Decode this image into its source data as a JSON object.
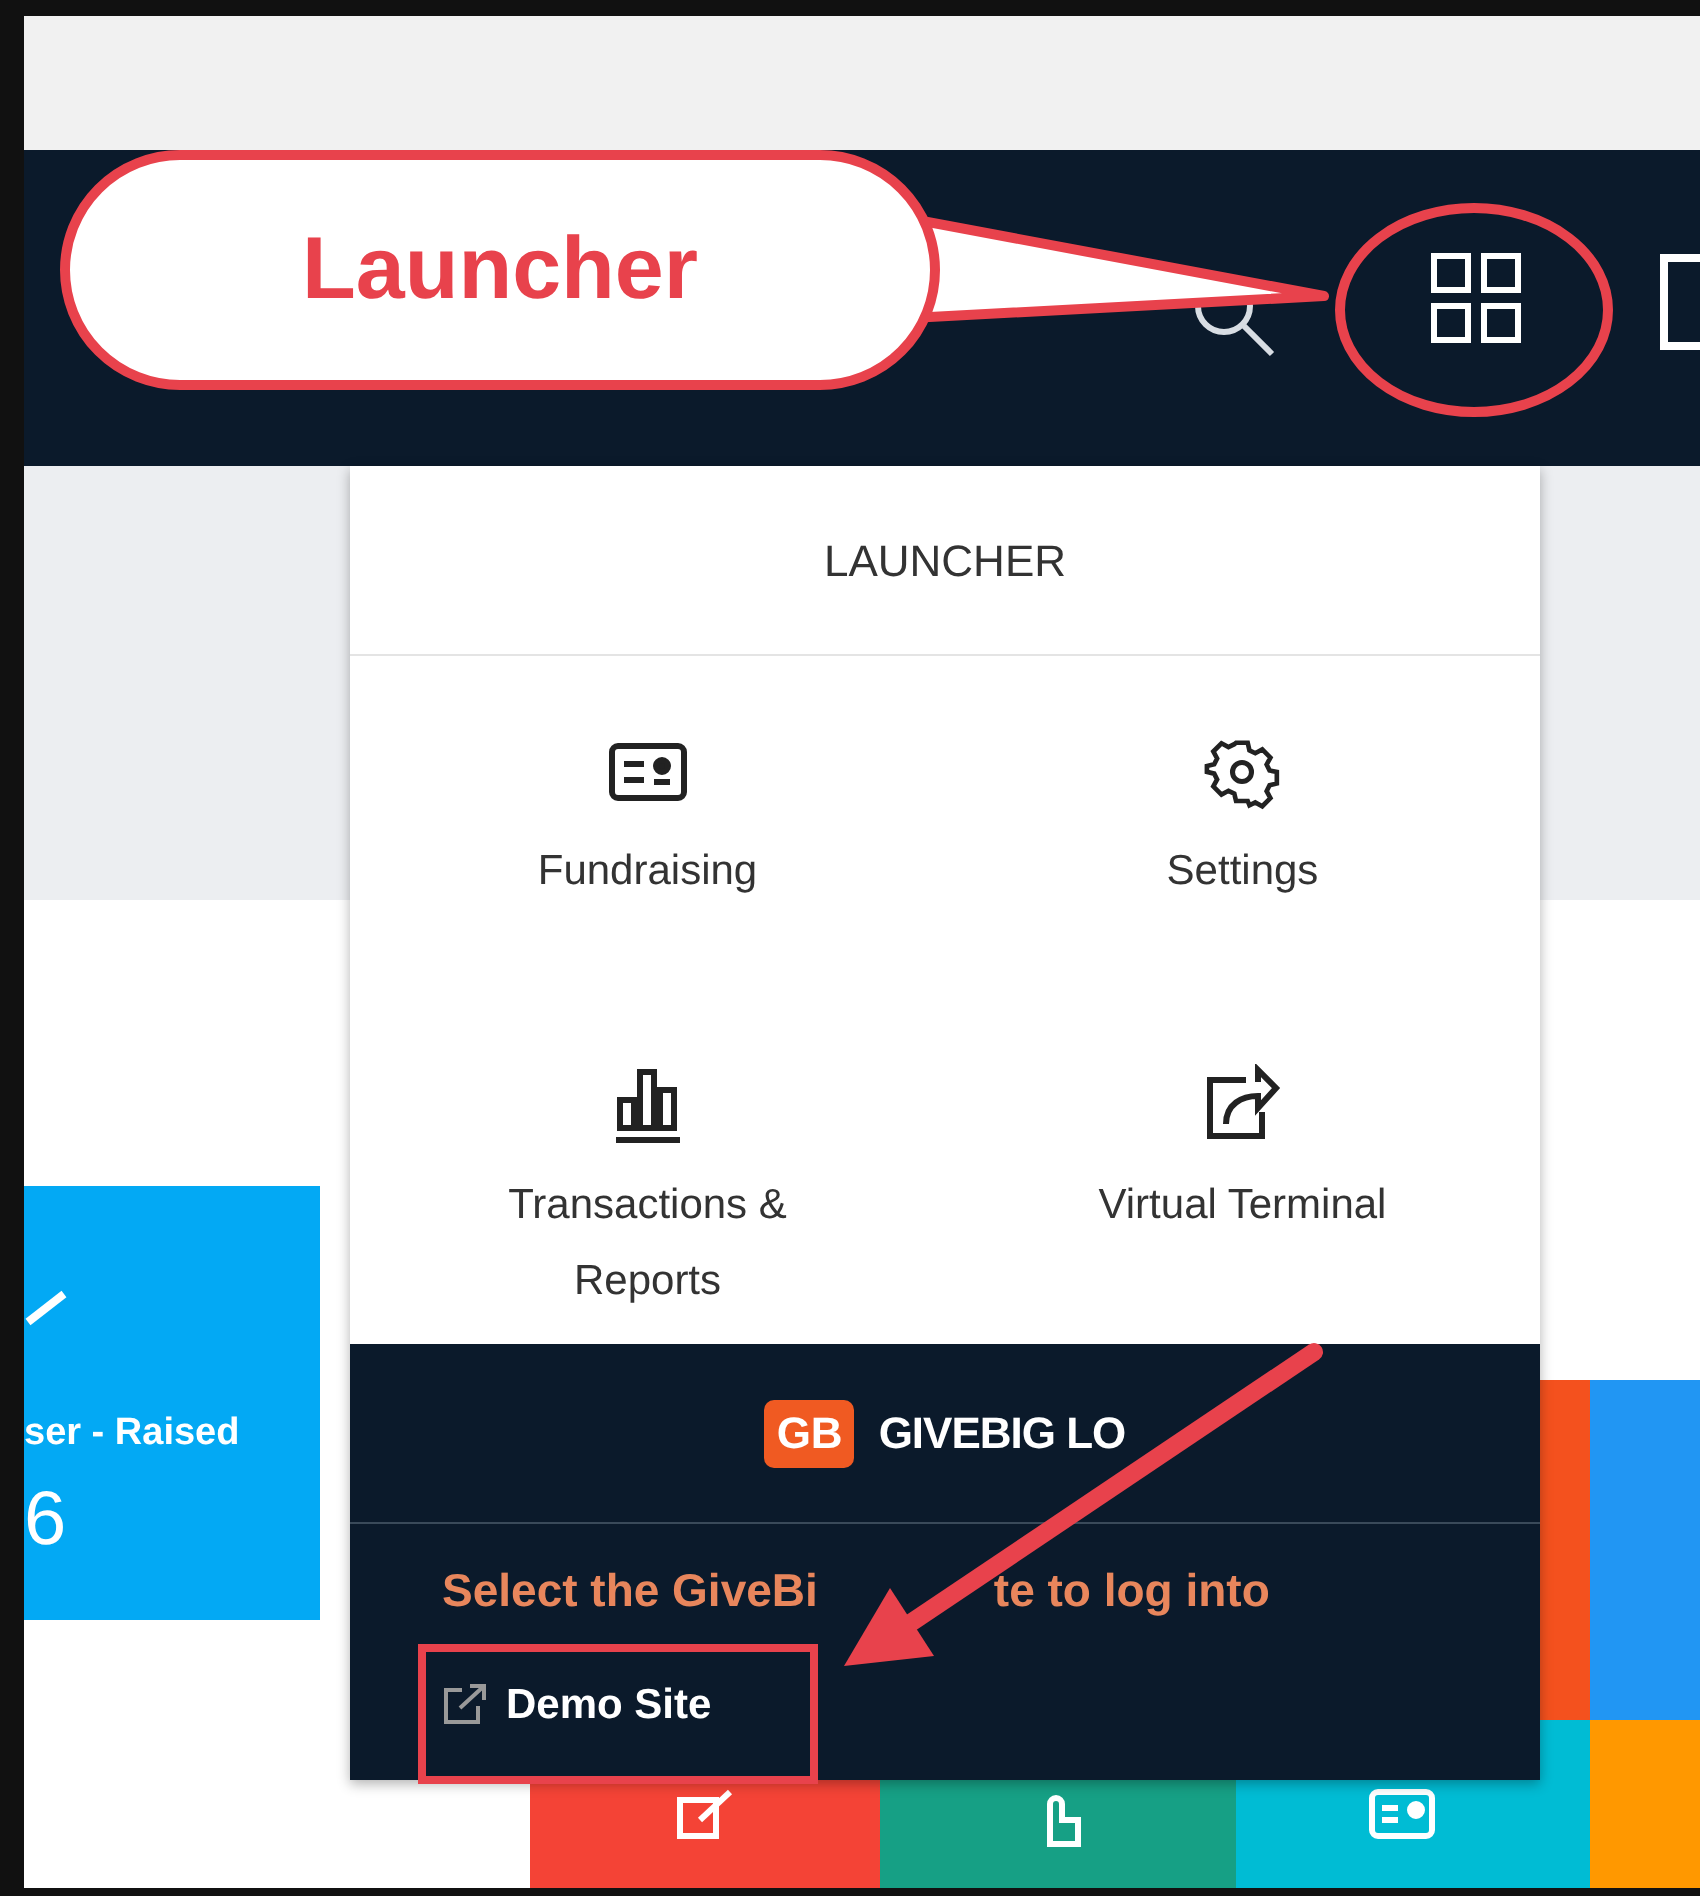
{
  "callout": {
    "text": "Launcher"
  },
  "launcher": {
    "title": "LAUNCHER",
    "items": [
      {
        "label": "Fundraising",
        "kind": "card"
      },
      {
        "label": "Settings",
        "kind": "gear"
      },
      {
        "label": "Transactions &\nReports",
        "kind": "chart"
      },
      {
        "label": "Virtual Terminal",
        "kind": "share"
      }
    ]
  },
  "givebig": {
    "logo": "GB",
    "title_parts": [
      "GIVEBIG LO"
    ],
    "prompt_parts": [
      "Select the GiveBi",
      "te to log into"
    ],
    "sites": [
      {
        "label": "Demo Site"
      }
    ]
  },
  "stat_card": {
    "label": "ser - Raised",
    "value": "6"
  }
}
